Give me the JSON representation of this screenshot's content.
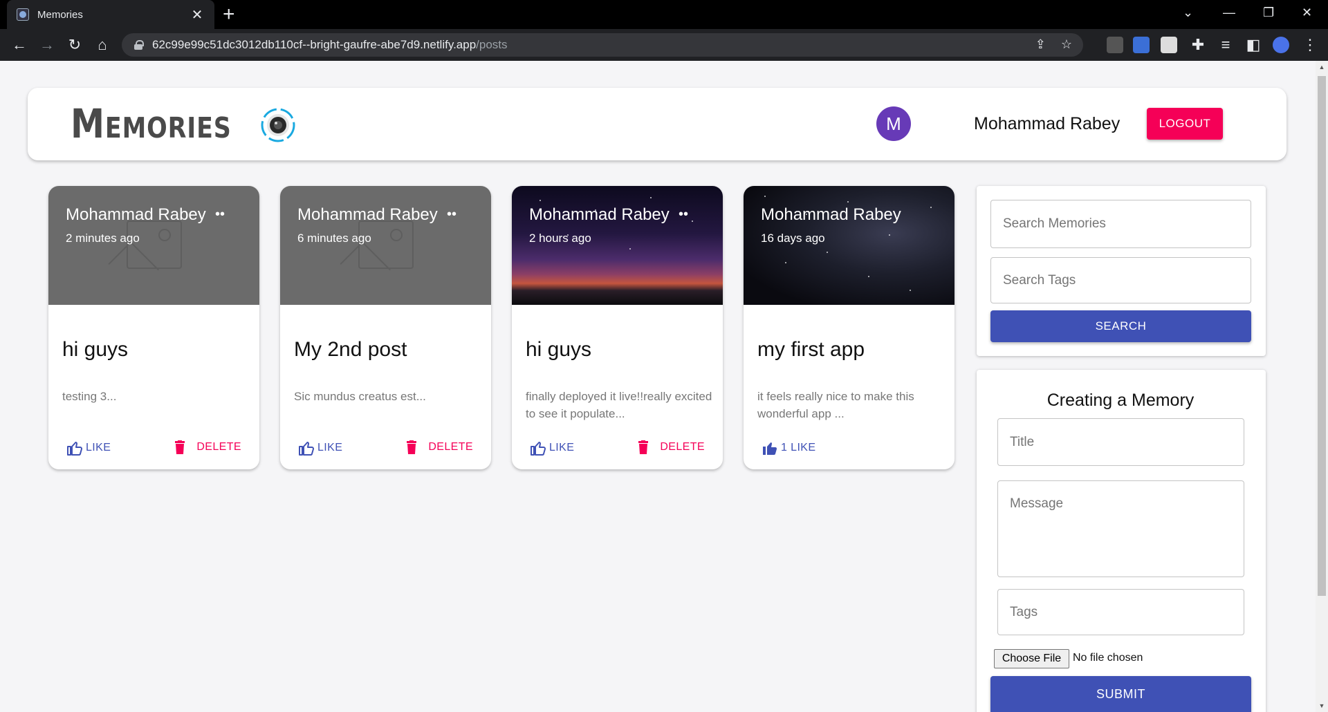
{
  "browser": {
    "tab_title": "Memories",
    "tab_close": "✕",
    "new_tab": "+",
    "url_host": "62c99e99c51dc3012db110cf--bright-gaufre-abe7d9.netlify.app",
    "url_path": "/posts",
    "icons": [
      "back-arrow-icon",
      "forward-arrow-icon",
      "reload-icon",
      "home-icon",
      "lock-icon",
      "share-icon",
      "star-icon",
      "extensions-icon",
      "reading-list-icon",
      "side-panel-icon",
      "profile-icon",
      "menu-icon"
    ]
  },
  "header": {
    "brand": "Memories",
    "avatar_letter": "M",
    "username": "Mohammad Rabey",
    "logout_label": "LOGOUT"
  },
  "posts": [
    {
      "author": "Mohammad Rabey",
      "time": "2 minutes ago",
      "title": "hi guys",
      "message": "testing 3...",
      "like_label": "LIKE",
      "delete_label": "DELETE",
      "image": "placeholder"
    },
    {
      "author": "Mohammad Rabey",
      "time": "6 minutes ago",
      "title": "My 2nd post",
      "message": "Sic mundus creatus est...",
      "like_label": "LIKE",
      "delete_label": "DELETE",
      "image": "placeholder"
    },
    {
      "author": "Mohammad Rabey",
      "time": "2 hours ago",
      "title": "hi guys",
      "message": "finally deployed it live!!really excited to see it populate...",
      "like_label": "LIKE",
      "delete_label": "DELETE",
      "image": "aurora-sky"
    },
    {
      "author": "Mohammad Rabey",
      "time": "16 days ago",
      "title": "my first app",
      "message": "it feels really nice to make this wonderful app ...",
      "like_label": "1 LIKE",
      "image": "starry-sky"
    }
  ],
  "search": {
    "memories_placeholder": "Search Memories",
    "tags_placeholder": "Search Tags",
    "button_label": "SEARCH"
  },
  "form": {
    "title": "Creating a Memory",
    "title_placeholder": "Title",
    "message_placeholder": "Message",
    "tags_placeholder": "Tags",
    "file_button": "Choose File",
    "file_status": "No file chosen",
    "submit_label": "SUBMIT"
  },
  "colors": {
    "primary": "#3f51b5",
    "secondary": "#f50057",
    "avatar": "#673ab7",
    "background": "#f5f5f7"
  }
}
